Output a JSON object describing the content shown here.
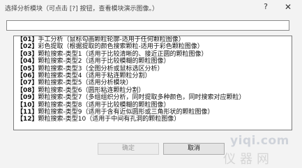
{
  "dialog": {
    "title": "选择分析模块（可点击 [?] 按钮，查看模块演示图像。）",
    "help_glyph": "?",
    "close_glyph": "✕"
  },
  "search": {
    "value": "",
    "placeholder": ""
  },
  "modules": [
    {
      "code": "【01】",
      "label": "手工分析（鼠标勾画颗粒轮廓-适用于任何颗粒图像）"
    },
    {
      "code": "【02】",
      "label": "彩色提取（根据提取的颜色搜索颗粒-适用于彩色颗粒图像）"
    },
    {
      "code": "【03】",
      "label": "颗粒搜索-类型1（适用于比较清晰的、接近正圆的颗粒图像）"
    },
    {
      "code": "【04】",
      "label": "颗粒搜索-类型2（适用于比较模糊的颗粒图像）"
    },
    {
      "code": "【05】",
      "label": "颗粒搜索-类型3（全图分析或鼠标选区分析）"
    },
    {
      "code": "【06】",
      "label": "颗粒搜索-类型4（适用于粘连颗粒分割）"
    },
    {
      "code": "【07】",
      "label": "颗粒搜索-类型5（适用分析模块）"
    },
    {
      "code": "【08】",
      "label": "颗粒搜索-类型6（圆形粘连颗粒分割）"
    },
    {
      "code": "【09】",
      "label": "颗粒搜索-类型7（多组组织分析，同时提取多种颜色，同时搜索对应颗粒）"
    },
    {
      "code": "【10】",
      "label": "颗粒搜索-类型8（适用于比较模糊的颗粒图像）"
    },
    {
      "code": "【11】",
      "label": "颗粒搜索-类型9（适用于含有近似圆形或三角形状的颗粒图像）"
    },
    {
      "code": "【12】",
      "label": "颗粒搜索-类型10（适用于中间有孔洞的颗粒图像）"
    }
  ],
  "buttons": {
    "ok": "确定",
    "cancel": "取消"
  },
  "watermark": {
    "url": "yiqi.com",
    "sub": "仪器网"
  }
}
